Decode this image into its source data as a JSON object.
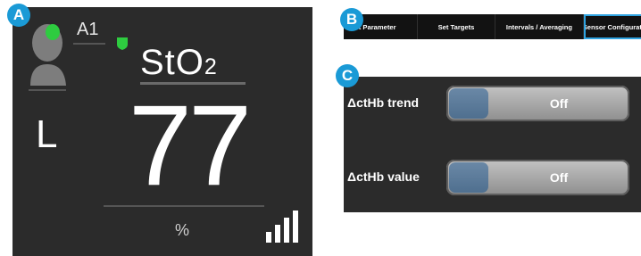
{
  "callouts": {
    "a": "A",
    "b": "B",
    "c": "C"
  },
  "monitor": {
    "channel": "A1",
    "parameter_main": "StO",
    "parameter_sub": "2",
    "side": "L",
    "value": "77",
    "unit": "%",
    "signal_strength": "4/4",
    "status_color": "#2ecc40"
  },
  "tabs": [
    {
      "label": "elect Parameter"
    },
    {
      "label": "Set Targets"
    },
    {
      "label": "Intervals / Averaging"
    },
    {
      "label": "Sensor Configuration",
      "selected": true
    }
  ],
  "toggles": [
    {
      "label": "ΔctHb trend",
      "state": "Off"
    },
    {
      "label": "ΔctHb value",
      "state": "Off"
    }
  ],
  "colors": {
    "accent": "#1a9ad6",
    "panel_bg": "#2b2b2b",
    "tab_border": "#2fa3e0",
    "toggle_knob": "#5c7c9c"
  }
}
